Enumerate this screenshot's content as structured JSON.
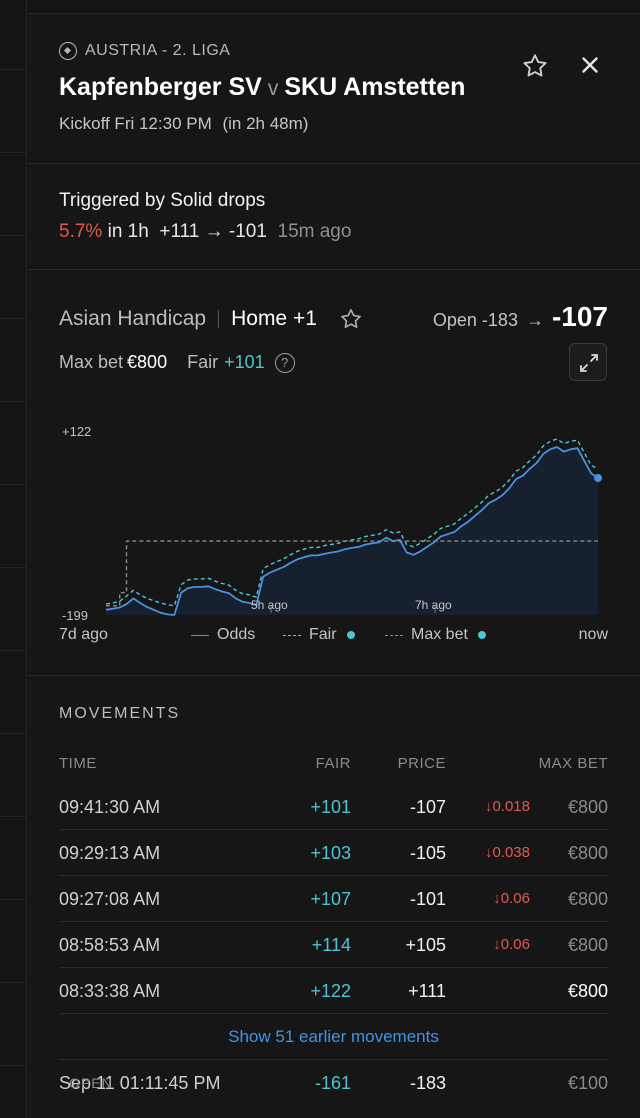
{
  "header": {
    "league": "AUSTRIA - 2. LIGA",
    "home_team": "Kapfenberger SV",
    "vs": "v",
    "away_team": "SKU Amstetten",
    "kickoff": "Kickoff Fri 12:30 PM",
    "kickoff_rel": "(in 2h 48m)",
    "close_glyph": "×"
  },
  "trigger": {
    "title": "Triggered by Solid drops",
    "pct": "5.7%",
    "window": "in 1h",
    "from": "+111",
    "arrow": "→",
    "to": "-101",
    "ago": "15m ago"
  },
  "market": {
    "name": "Asian Handicap",
    "line": "Home +1",
    "open_label": "Open -183",
    "arrow": "→",
    "current": "-107",
    "max_bet_label": "Max bet",
    "max_bet_value": "€800",
    "fair_label": "Fair",
    "fair_value": "+101",
    "help_glyph": "?"
  },
  "chart_data": {
    "type": "line",
    "y_top_label": "+122",
    "y_bottom_label": "-199",
    "x_tick_labels": [
      "7d ago",
      "5h ago",
      "7h ago",
      "now"
    ],
    "series": [
      {
        "name": "Odds",
        "color": "#4a90e2",
        "values": [
          -190,
          -188,
          -186,
          -180,
          -170,
          -178,
          -185,
          -190,
          -195,
          -198,
          -199,
          -160,
          -152,
          -150,
          -150,
          -149,
          -154,
          -158,
          -161,
          -170,
          -176,
          -178,
          -182,
          -132,
          -125,
          -120,
          -115,
          -108,
          -102,
          -98,
          -95,
          -95,
          -92,
          -90,
          -88,
          -84,
          -82,
          -80,
          -76,
          -74,
          -72,
          -64,
          -70,
          -68,
          -90,
          -94,
          -88,
          -80,
          -72,
          -62,
          -58,
          -54,
          -44,
          -36,
          -26,
          -16,
          -4,
          2,
          10,
          22,
          38,
          44,
          56,
          66,
          82,
          90,
          94,
          86,
          90,
          92,
          70,
          48,
          40
        ]
      },
      {
        "name": "Fair",
        "color": "#4fc4d4",
        "dashed": true,
        "values": [
          -180,
          -178,
          -175,
          -166,
          -156,
          -164,
          -170,
          -174,
          -178,
          -181,
          -183,
          -146,
          -138,
          -136,
          -136,
          -135,
          -140,
          -144,
          -147,
          -156,
          -162,
          -164,
          -168,
          -118,
          -111,
          -106,
          -101,
          -94,
          -88,
          -84,
          -81,
          -81,
          -78,
          -76,
          -74,
          -70,
          -68,
          -66,
          -62,
          -60,
          -58,
          -50,
          -56,
          -54,
          -76,
          -80,
          -74,
          -66,
          -58,
          -48,
          -44,
          -40,
          -30,
          -22,
          -12,
          -2,
          10,
          16,
          24,
          36,
          52,
          58,
          70,
          80,
          96,
          104,
          108,
          100,
          104,
          106,
          84,
          62,
          56
        ]
      },
      {
        "name": "Max bet",
        "color": "#8a8a8a",
        "dashed": true,
        "steps": true,
        "values": [
          -183,
          -183,
          -160,
          -70,
          -70,
          -70,
          -70,
          -70,
          -70,
          -70,
          -70,
          -70,
          -70,
          -70,
          -70,
          -70,
          -70,
          -70,
          -70,
          -70,
          -70,
          -70,
          -70,
          -70,
          -70,
          -70,
          -70,
          -70,
          -70,
          -70,
          -70,
          -70,
          -70,
          -70,
          -70,
          -70,
          -70,
          -70,
          -70,
          -70,
          -70,
          -70,
          -70,
          -70,
          -70,
          -70,
          -70,
          -70,
          -70,
          -70,
          -70,
          -70,
          -70,
          -70,
          -70,
          -70,
          -70,
          -70,
          -70,
          -70,
          -70,
          -70,
          -70,
          -70,
          -70,
          -70,
          -70,
          -70,
          -70,
          -70,
          -70,
          -70,
          -70
        ]
      }
    ],
    "ylim": [
      -199,
      122
    ]
  },
  "legend": {
    "odds": "Odds",
    "fair": "Fair",
    "max_bet": "Max bet"
  },
  "movements": {
    "title": "MOVEMENTS",
    "headers": {
      "time": "TIME",
      "fair": "FAIR",
      "price": "PRICE",
      "max_bet": "MAX BET"
    },
    "rows": [
      {
        "time": "09:41:30 AM",
        "fair": "+101",
        "price": "-107",
        "delta": "↓0.018",
        "max_bet": "€800"
      },
      {
        "time": "09:29:13 AM",
        "fair": "+103",
        "price": "-105",
        "delta": "↓0.038",
        "max_bet": "€800"
      },
      {
        "time": "09:27:08 AM",
        "fair": "+107",
        "price": "-101",
        "delta": "↓0.06",
        "max_bet": "€800"
      },
      {
        "time": "08:58:53 AM",
        "fair": "+114",
        "price": "+105",
        "delta": "↓0.06",
        "max_bet": "€800"
      },
      {
        "time": "08:33:38 AM",
        "fair": "+122",
        "price": "+111",
        "delta": "",
        "max_bet": "€800"
      }
    ],
    "show_more": "Show 51 earlier movements",
    "open_row": {
      "time": "Sep 11 01:11:45 PM",
      "tag": "OPEN",
      "fair": "-161",
      "price": "-183",
      "max_bet": "€100"
    }
  }
}
